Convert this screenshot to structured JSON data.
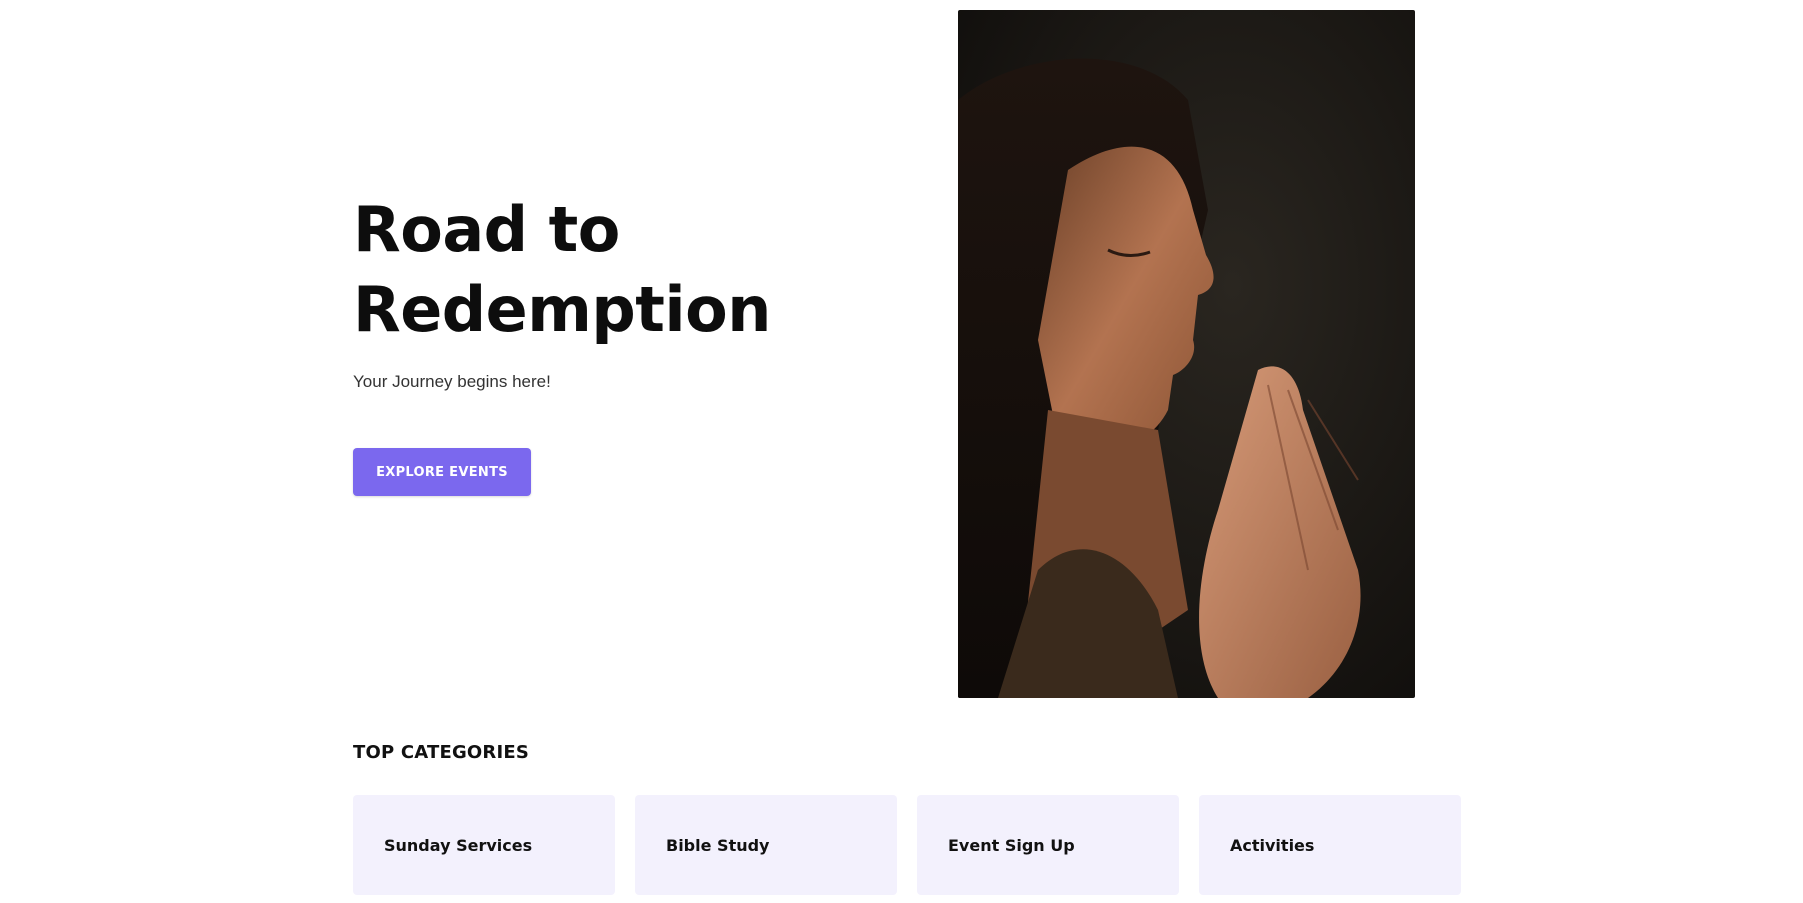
{
  "hero": {
    "title_line1": "Road to",
    "title_line2": "Redemption",
    "subtitle": "Your Journey begins here!",
    "cta_label": "EXPLORE EVENTS"
  },
  "categories": {
    "heading": "TOP CATEGORIES",
    "items": [
      {
        "label": "Sunday Services"
      },
      {
        "label": "Bible Study"
      },
      {
        "label": "Event Sign Up"
      },
      {
        "label": "Activities"
      }
    ]
  },
  "colors": {
    "accent": "#7b68ee",
    "card_background": "#f3f1fd",
    "text_primary": "#0d0d0d"
  },
  "image": {
    "subject": "woman-praying-photo"
  }
}
